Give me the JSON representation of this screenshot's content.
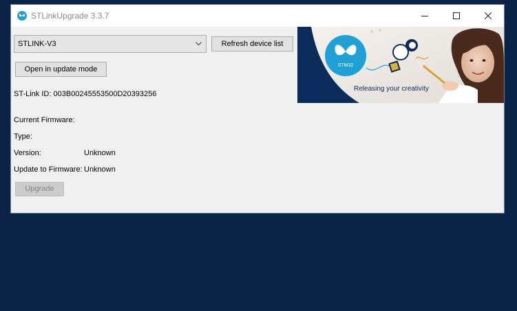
{
  "window": {
    "title": "STLinkUpgrade 3.3.7"
  },
  "device": {
    "selected": "STLINK-V3",
    "refresh_label": "Refresh device list",
    "update_mode_label": "Open in update mode",
    "stlink_id": "ST-Link ID: 003B00245553500D20393256"
  },
  "info": {
    "current_firmware_label": "Current Firmware:",
    "type_label": "Type:",
    "version_label": "Version:",
    "version_value": "Unknown",
    "update_to_label": "Update to Firmware:",
    "update_to_value": "Unknown"
  },
  "actions": {
    "upgrade_label": "Upgrade"
  },
  "banner": {
    "logo_text": "STM32",
    "tagline": "Releasing your creativity"
  },
  "colors": {
    "desktop": "#0b2347",
    "window_bg": "#f0f0f0",
    "banner_dark": "#0b2c5a",
    "st_blue": "#1fa0d7"
  }
}
